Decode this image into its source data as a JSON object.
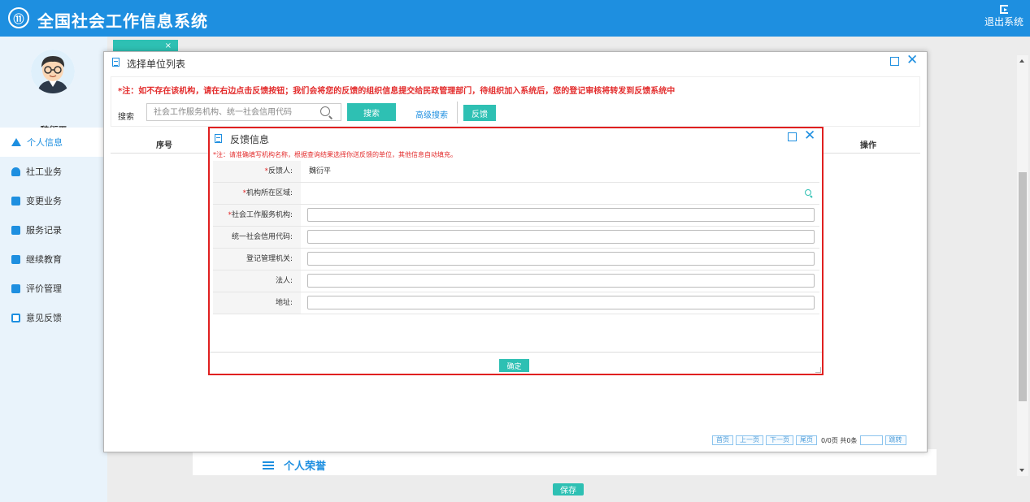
{
  "header": {
    "logo_char": "⑪",
    "title": "全国社会工作信息系统",
    "logout_label": "退出系统"
  },
  "sidebar": {
    "user_name": "魏衍平",
    "items": [
      {
        "label": "个人信息",
        "icon": "home-icon"
      },
      {
        "label": "社工业务",
        "icon": "people-icon"
      },
      {
        "label": "变更业务",
        "icon": "building-icon"
      },
      {
        "label": "服务记录",
        "icon": "record-icon"
      },
      {
        "label": "继续教育",
        "icon": "education-icon"
      },
      {
        "label": "评价管理",
        "icon": "list-icon"
      },
      {
        "label": "意见反馈",
        "icon": "feedback-icon"
      }
    ]
  },
  "background": {
    "honor_title": "个人荣誉",
    "save_label": "保存"
  },
  "outer_dialog": {
    "title": "选择单位列表",
    "notice": "*注：如不存在该机构，请在右边点击反馈按钮；我们会将您的反馈的组织信息提交给民政管理部门，待组织加入系统后，您的登记审核将转发到反馈系统中",
    "search_label": "搜索",
    "search_placeholder": "社会工作服务机构、统一社会信用代码",
    "search_button": "搜索",
    "advanced_search": "高级搜索",
    "feedback_button": "反馈",
    "columns": {
      "seq": "序号",
      "op": "操作"
    },
    "pager": {
      "first": "首页",
      "prev": "上一页",
      "next": "下一页",
      "last": "尾页",
      "info": "0/0页 共0条",
      "jump": "跳转"
    }
  },
  "inner_dialog": {
    "title": "反馈信息",
    "notice": "*注：请准确填写机构名称，根据查询结果选择你送反馈的单位，其他信息自动填充。",
    "fields": [
      {
        "label": "反馈人:",
        "required": "*",
        "value": "魏衍平"
      },
      {
        "label": "机构所在区域:",
        "required": "*",
        "value": ""
      },
      {
        "label": "社会工作服务机构:",
        "required": "*",
        "value": ""
      },
      {
        "label": "统一社会信用代码:",
        "required": "",
        "value": ""
      },
      {
        "label": "登记管理机关:",
        "required": "",
        "value": ""
      },
      {
        "label": "法人:",
        "required": "",
        "value": ""
      },
      {
        "label": "地址:",
        "required": "",
        "value": ""
      }
    ],
    "confirm_label": "确定"
  },
  "colors": {
    "header_blue": "#1e8fe0",
    "teal_button": "#2ec0b3",
    "notice_red": "#e32d2d",
    "highlight_border": "#e02020"
  }
}
